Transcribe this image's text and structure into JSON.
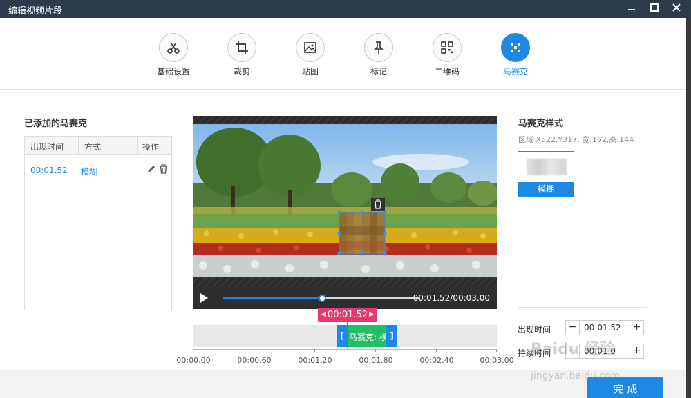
{
  "window": {
    "title": "编辑视频片段",
    "buttons": [
      "minimize",
      "maximize",
      "close"
    ]
  },
  "toolbar": {
    "tools": [
      {
        "label": "基础设置",
        "icon": "scissors-icon",
        "active": false
      },
      {
        "label": "裁剪",
        "icon": "crop-icon",
        "active": false
      },
      {
        "label": "贴图",
        "icon": "image-icon",
        "active": false
      },
      {
        "label": "标记",
        "icon": "pin-icon",
        "active": false
      },
      {
        "label": "二维码",
        "icon": "qrcode-icon",
        "active": false
      },
      {
        "label": "马赛克",
        "icon": "mosaic-icon",
        "active": true
      }
    ]
  },
  "left_panel": {
    "title": "已添加的马赛克",
    "columns": [
      "出现时间",
      "方式",
      "操作"
    ],
    "rows": [
      {
        "time": "00:01.52",
        "mode": "模糊"
      }
    ]
  },
  "player": {
    "timecode": "00:01.52/00:03.00",
    "progress": 0.507
  },
  "timeline": {
    "current_time": "00:01.52",
    "clip_label": "马赛克: 模",
    "ticks": [
      "00:00.00",
      "00:00.60",
      "00:01.20",
      "00:01.80",
      "00:02.40",
      "00:03.00"
    ]
  },
  "right_panel": {
    "title": "马赛克样式",
    "area": "区域 X522,Y317, 宽:162,高:144",
    "style_label": "模糊",
    "appear_label": "出现时间",
    "appear_value": "00:01.52",
    "duration_label": "持续时间",
    "duration_value": "00:01.0"
  },
  "footer": {
    "done_label": "完 成"
  },
  "watermark": {
    "brand": "Baidu 经验",
    "url": "jingyan.baidu.com"
  },
  "colors": {
    "accent": "#1e88e5",
    "playhead": "#e8396a",
    "clip": "#22c064",
    "titlebar": "#2d3a4a"
  }
}
